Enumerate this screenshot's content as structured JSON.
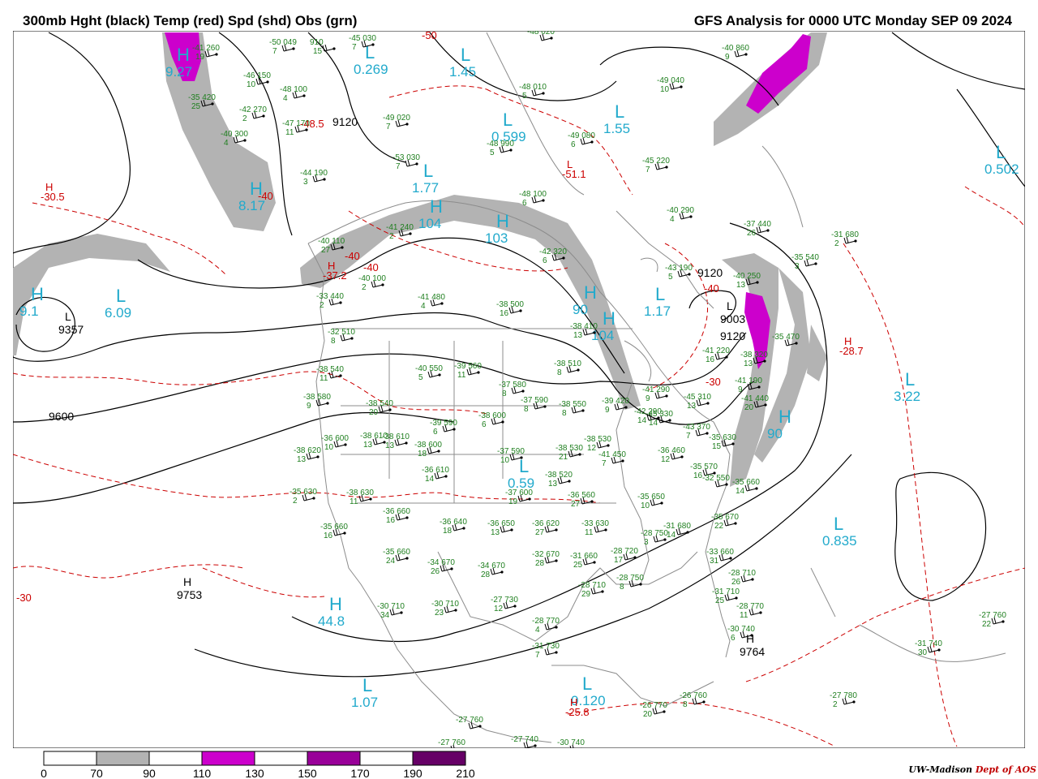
{
  "header": {
    "left_title": "300mb Hght (black) Temp (red) Spd (shd) Obs (grn)",
    "right_title": "GFS Analysis for 0000 UTC Monday  SEP 09 2024"
  },
  "credit": {
    "uw": "UW-Madison",
    "dept": "Dept of AOS"
  },
  "legend": {
    "ticks": [
      "0",
      "70",
      "90",
      "110",
      "130",
      "150",
      "170",
      "190",
      "210"
    ],
    "colors": [
      "#ffffff",
      "#b3b3b3",
      "#ffffff",
      "#cc00cc",
      "#ffffff",
      "#990099",
      "#ffffff",
      "#660066"
    ]
  },
  "pressure_centers": [
    {
      "letter": "H",
      "value": "9.27"
    },
    {
      "letter": "L",
      "value": "1.45"
    },
    {
      "letter": "L",
      "value": "0.269"
    },
    {
      "letter": "L",
      "value": "0.599"
    },
    {
      "letter": "L",
      "value": "1.55"
    },
    {
      "letter": "L",
      "value": "1.77"
    },
    {
      "letter": "H",
      "value": "8.17"
    },
    {
      "letter": "H",
      "value": "104"
    },
    {
      "letter": "H",
      "value": "103"
    },
    {
      "letter": "H",
      "value": "9.1"
    },
    {
      "letter": "L",
      "value": "6.09"
    },
    {
      "letter": "L",
      "value": "0.502"
    },
    {
      "letter": "H",
      "value": "90"
    },
    {
      "letter": "H",
      "value": "104"
    },
    {
      "letter": "L",
      "value": "1.17"
    },
    {
      "letter": "L",
      "value": "3.22"
    },
    {
      "letter": "L",
      "value": "0.59"
    },
    {
      "letter": "L",
      "value": "0.835"
    },
    {
      "letter": "H",
      "value": "44.8"
    },
    {
      "letter": "L",
      "value": "1.07"
    },
    {
      "letter": "L",
      "value": "0.120"
    },
    {
      "letter": "H",
      "value": "90"
    }
  ],
  "height_labels": [
    {
      "letter": "",
      "value": "9120"
    },
    {
      "letter": "L",
      "value": "9357"
    },
    {
      "letter": "",
      "value": "9600"
    },
    {
      "letter": "H",
      "value": "9753"
    },
    {
      "letter": "",
      "value": "9120"
    },
    {
      "letter": "L",
      "value": "9003"
    },
    {
      "letter": "",
      "value": "9120"
    },
    {
      "letter": "H",
      "value": "9764"
    }
  ],
  "temp_labels": [
    {
      "letter": "H",
      "value": "-30.5"
    },
    {
      "letter": "",
      "value": "-48.5"
    },
    {
      "letter": "",
      "value": "-50"
    },
    {
      "letter": "H",
      "value": "-37.2"
    },
    {
      "letter": "",
      "value": "-40"
    },
    {
      "letter": "L",
      "value": "-51.1"
    },
    {
      "letter": "",
      "value": "-40"
    },
    {
      "letter": "",
      "value": "-40"
    },
    {
      "letter": "",
      "value": "-30"
    },
    {
      "letter": "H",
      "value": "-28.7"
    },
    {
      "letter": "",
      "value": "-30"
    },
    {
      "letter": "H",
      "value": "-25.8"
    },
    {
      "letter": "",
      "value": "-40"
    }
  ],
  "observations": [
    {
      "top": "-41 260",
      "bot": "19"
    },
    {
      "top": "-50 049",
      "bot": "7"
    },
    {
      "top": "910",
      "bot": "15"
    },
    {
      "top": "-45 030",
      "bot": "7"
    },
    {
      "top": "-48 020",
      "bot": ""
    },
    {
      "top": "-46 150",
      "bot": "10"
    },
    {
      "top": "-48 100",
      "bot": "4"
    },
    {
      "top": "-35 420",
      "bot": "25"
    },
    {
      "top": "-42 270",
      "bot": "2"
    },
    {
      "top": "-47 170",
      "bot": "11"
    },
    {
      "top": "-40 300",
      "bot": "4"
    },
    {
      "top": "-49 020",
      "bot": "7"
    },
    {
      "top": "-48 010",
      "bot": "5"
    },
    {
      "top": "-48 990",
      "bot": "5"
    },
    {
      "top": "-49 080",
      "bot": "6"
    },
    {
      "top": "-49 040",
      "bot": "10"
    },
    {
      "top": "-40 860",
      "bot": "9"
    },
    {
      "top": "-53 030",
      "bot": "7"
    },
    {
      "top": "-44 190",
      "bot": "3"
    },
    {
      "top": "-45 220",
      "bot": "7"
    },
    {
      "top": "-48 100",
      "bot": "6"
    },
    {
      "top": "-40 290",
      "bot": "4"
    },
    {
      "top": "-37 440",
      "bot": "26"
    },
    {
      "top": "-41 240",
      "bot": "2"
    },
    {
      "top": "-40 110",
      "bot": "27"
    },
    {
      "top": "-42 320",
      "bot": "6"
    },
    {
      "top": "-31 680",
      "bot": "2"
    },
    {
      "top": "-35 540",
      "bot": "3"
    },
    {
      "top": "-40 100",
      "bot": "2"
    },
    {
      "top": "-43 190",
      "bot": "5"
    },
    {
      "top": "-40 250",
      "bot": "13"
    },
    {
      "top": "-41 480",
      "bot": "4"
    },
    {
      "top": "-38 500",
      "bot": "16"
    },
    {
      "top": "-33 440",
      "bot": "2"
    },
    {
      "top": "-32 510",
      "bot": "8"
    },
    {
      "top": "-38 410",
      "bot": "13"
    },
    {
      "top": "-41 220",
      "bot": "16"
    },
    {
      "top": "-38 320",
      "bot": "13"
    },
    {
      "top": "-35 470",
      "bot": ""
    },
    {
      "top": "-38 540",
      "bot": "11"
    },
    {
      "top": "-40 550",
      "bot": "5"
    },
    {
      "top": "-39 560",
      "bot": "11"
    },
    {
      "top": "-38 510",
      "bot": "8"
    },
    {
      "top": "-41 290",
      "bot": "9"
    },
    {
      "top": "-41 190",
      "bot": "9"
    },
    {
      "top": "-37 580",
      "bot": "8"
    },
    {
      "top": "-37 590",
      "bot": "8"
    },
    {
      "top": "-38 550",
      "bot": "8"
    },
    {
      "top": "-39 420",
      "bot": "9"
    },
    {
      "top": "-42 290",
      "bot": "14"
    },
    {
      "top": "-45 310",
      "bot": "13"
    },
    {
      "top": "-38 580",
      "bot": "9"
    },
    {
      "top": "-38 540",
      "bot": "20"
    },
    {
      "top": "-38 600",
      "bot": "6"
    },
    {
      "top": "-39 590",
      "bot": "6"
    },
    {
      "top": "-45 330",
      "bot": "14"
    },
    {
      "top": "-41 440",
      "bot": "20"
    },
    {
      "top": "-43 370",
      "bot": "7"
    },
    {
      "top": "-36 600",
      "bot": "10"
    },
    {
      "top": "-38 610",
      "bot": "13"
    },
    {
      "top": "-38 610",
      "bot": "13"
    },
    {
      "top": "-38 600",
      "bot": "18"
    },
    {
      "top": "-37 590",
      "bot": "10"
    },
    {
      "top": "-38 530",
      "bot": "21"
    },
    {
      "top": "-38 530",
      "bot": "12"
    },
    {
      "top": "-41 450",
      "bot": "7"
    },
    {
      "top": "-36 460",
      "bot": "12"
    },
    {
      "top": "-35 630",
      "bot": "15"
    },
    {
      "top": "-38 620",
      "bot": "13"
    },
    {
      "top": "-36 610",
      "bot": "14"
    },
    {
      "top": "-38 520",
      "bot": "13"
    },
    {
      "top": "-35 570",
      "bot": "16"
    },
    {
      "top": "-32 550",
      "bot": ""
    },
    {
      "top": "-35 660",
      "bot": "14"
    },
    {
      "top": "-35 630",
      "bot": "2"
    },
    {
      "top": "-38 630",
      "bot": "11"
    },
    {
      "top": "-37 600",
      "bot": "19"
    },
    {
      "top": "-36 560",
      "bot": "27"
    },
    {
      "top": "-35 650",
      "bot": "10"
    },
    {
      "top": "-36 660",
      "bot": "16"
    },
    {
      "top": "-36 640",
      "bot": "18"
    },
    {
      "top": "-36 650",
      "bot": "13"
    },
    {
      "top": "-36 620",
      "bot": "27"
    },
    {
      "top": "-33 630",
      "bot": "11"
    },
    {
      "top": "-31 680",
      "bot": "14"
    },
    {
      "top": "-35 670",
      "bot": "22"
    },
    {
      "top": "-35 660",
      "bot": "16"
    },
    {
      "top": "-35 660",
      "bot": "24"
    },
    {
      "top": "-34 670",
      "bot": "26"
    },
    {
      "top": "-34 670",
      "bot": "28"
    },
    {
      "top": "-32 670",
      "bot": "28"
    },
    {
      "top": "-31 660",
      "bot": "25"
    },
    {
      "top": "-28 720",
      "bot": "17"
    },
    {
      "top": "-33 660",
      "bot": "31"
    },
    {
      "top": "-28 750",
      "bot": "3"
    },
    {
      "top": "-28 710",
      "bot": "26"
    },
    {
      "top": "-28 710",
      "bot": "29"
    },
    {
      "top": "-28 750",
      "bot": "8"
    },
    {
      "top": "-31 710",
      "bot": "25"
    },
    {
      "top": "-30 710",
      "bot": "34"
    },
    {
      "top": "-30 710",
      "bot": "23"
    },
    {
      "top": "-27 730",
      "bot": "12"
    },
    {
      "top": "-28 770",
      "bot": "4"
    },
    {
      "top": "-28 770",
      "bot": "11"
    },
    {
      "top": "-30 740",
      "bot": "6"
    },
    {
      "top": "-27 760",
      "bot": "22"
    },
    {
      "top": "-31 730",
      "bot": "7"
    },
    {
      "top": "-31 740",
      "bot": "30"
    },
    {
      "top": "-27 780",
      "bot": "2"
    },
    {
      "top": "-26 770",
      "bot": "20"
    },
    {
      "top": "-26 760",
      "bot": "8"
    },
    {
      "top": "-27 760",
      "bot": ""
    },
    {
      "top": "-27 760",
      "bot": ""
    },
    {
      "top": "-27 740",
      "bot": ""
    },
    {
      "top": "-30 740",
      "bot": "5"
    }
  ]
}
